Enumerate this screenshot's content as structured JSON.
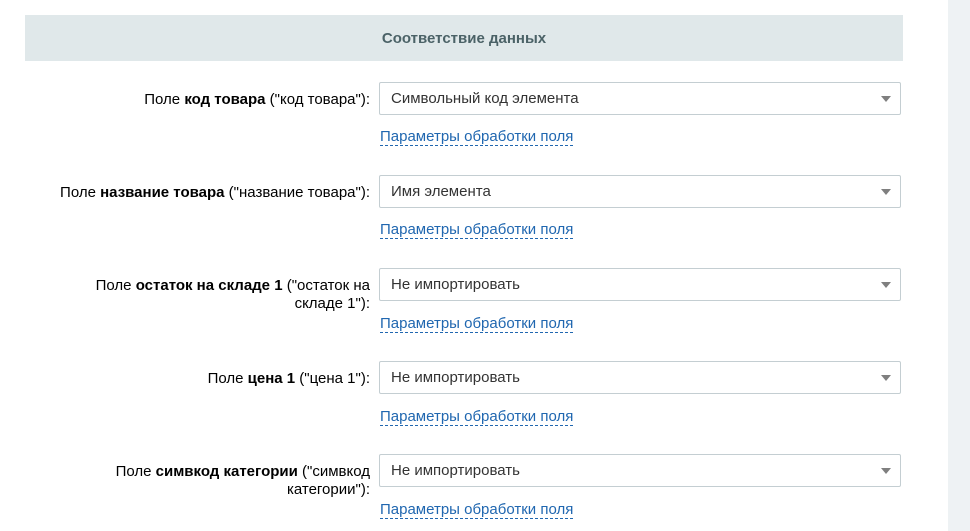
{
  "section": {
    "title": "Соответствие данных"
  },
  "fields": [
    {
      "prefix": "Поле ",
      "name": "код товара",
      "suffix": " (\"код товара\"):",
      "selected": "Символьный код элемента",
      "link": "Параметры обработки поля"
    },
    {
      "prefix": "Поле ",
      "name": "название товара",
      "suffix": " (\"название товара\"):",
      "selected": "Имя элемента",
      "link": "Параметры обработки поля"
    },
    {
      "prefix": "Поле ",
      "name": "остаток на складе 1",
      "suffix": " (\"остаток на складе 1\"):",
      "selected": "Не импортировать",
      "link": "Параметры обработки поля"
    },
    {
      "prefix": "Поле ",
      "name": "цена 1",
      "suffix": " (\"цена 1\"):",
      "selected": "Не импортировать",
      "link": "Параметры обработки поля"
    },
    {
      "prefix": "Поле ",
      "name": "симвкод категории",
      "suffix": " (\"симвкод категории\"):",
      "selected": "Не импортировать",
      "link": "Параметры обработки поля"
    }
  ],
  "icons": {
    "dropdown": "chevron-down-icon"
  }
}
